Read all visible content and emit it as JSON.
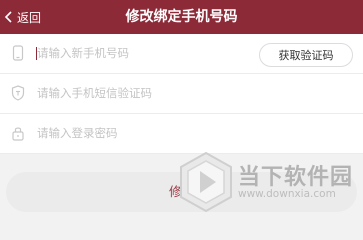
{
  "header": {
    "back_label": "返回",
    "title": "修改绑定手机号码",
    "background": "#8c2a38"
  },
  "form": {
    "phone": {
      "placeholder": "请输入新手机号码",
      "icon": "phone-icon"
    },
    "get_code_button": "获取验证码",
    "sms_code": {
      "placeholder": "请输入手机短信验证码",
      "icon": "shield-icon"
    },
    "password": {
      "placeholder": "请输入登录密码",
      "icon": "lock-icon"
    }
  },
  "submit_label": "修改",
  "watermark": {
    "text": "当下软件园",
    "url": "www.downxia.com"
  }
}
